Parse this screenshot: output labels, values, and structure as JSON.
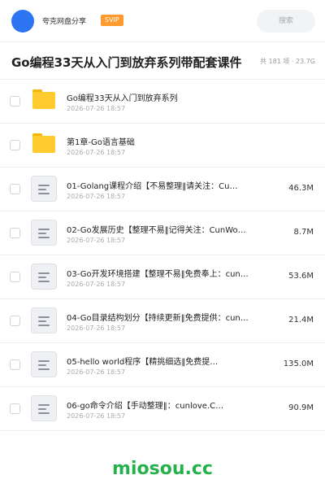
{
  "header": {
    "app_name": "夸克网盘分享",
    "badge": "SVIP",
    "search_label": "搜索",
    "avatar_color": "#2c74f2"
  },
  "title_bar": {
    "title": "Go编程33天从入门到放弃系列带配套课件",
    "meta": "共 181 项 · 23.7G"
  },
  "files": [
    {
      "type": "folder",
      "icon": "folder-icon",
      "name": "Go编程33天从入门到放弃系列",
      "date": "2026-07-26 18:57",
      "size": ""
    },
    {
      "type": "folder",
      "icon": "folder-icon",
      "name": "第1章-Go语言基础",
      "date": "2026-07-26 18:57",
      "size": ""
    },
    {
      "type": "file",
      "icon": "document-icon",
      "name": "01-Golang课程介绍【不易整理‖请关注：Cu…",
      "date": "2026-07-26 18:57",
      "size": "46.3M"
    },
    {
      "type": "file",
      "icon": "document-icon",
      "name": "02-Go发展历史【整理不易‖记得关注：CunWo…",
      "date": "2026-07-26 18:57",
      "size": "8.7M"
    },
    {
      "type": "file",
      "icon": "document-icon",
      "name": "03-Go开发环境搭建【整理不易‖免费奉上：cun…",
      "date": "2026-07-26 18:57",
      "size": "53.6M"
    },
    {
      "type": "file",
      "icon": "document-icon",
      "name": "04-Go目录结构划分【持续更新‖免费提供：cun…",
      "date": "2026-07-26 18:57",
      "size": "21.4M"
    },
    {
      "type": "file",
      "icon": "document-icon",
      "name": "05-hello world程序【精挑细选‖免费提…",
      "date": "2026-07-26 18:57",
      "size": "135.0M"
    },
    {
      "type": "file",
      "icon": "document-icon",
      "name": "06-go命令介绍【手动整理‖：cunlove.C…",
      "date": "2026-07-26 18:57",
      "size": "90.9M"
    }
  ],
  "watermark": "miosou.cc",
  "colors": {
    "accent": "#2c74f2",
    "badge": "#ff9a2e",
    "folder": "#ffcb2e",
    "watermark": "#27b14d"
  }
}
